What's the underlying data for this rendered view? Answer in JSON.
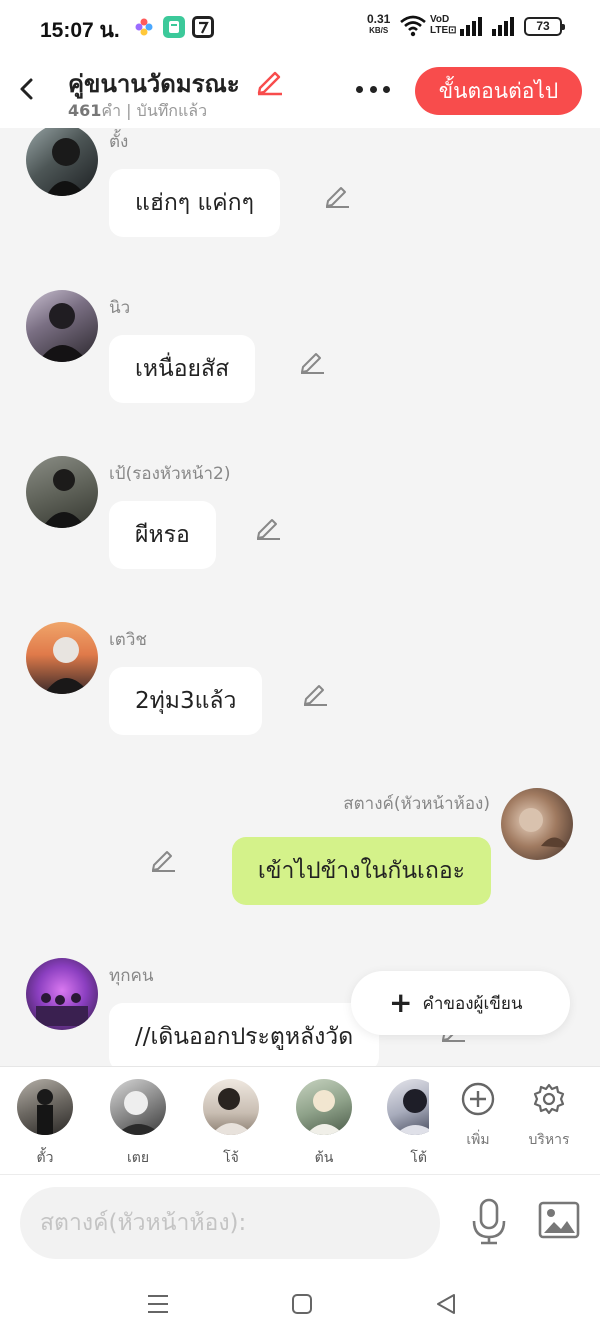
{
  "status_bar": {
    "time": "15:07 น.",
    "net_speed_value": "0.31",
    "net_speed_unit": "KB/S",
    "volte_top": "VoD",
    "volte_bottom": "LTE⊡",
    "battery": "73"
  },
  "header": {
    "title": "คู่ขนานวัดมรณะ",
    "word_count": "461",
    "word_unit": "คำ",
    "saved_status": "บันทึกแล้ว",
    "next_button": "ขั้นตอนต่อไป"
  },
  "messages": [
    {
      "speaker": "ตั้ง",
      "text": "แฮ่กๆ แค่กๆ",
      "side": "left"
    },
    {
      "speaker": "นิว",
      "text": "เหนื่อยสัส",
      "side": "left"
    },
    {
      "speaker": "เป้(รองหัวหน้า2)",
      "text": "ผีหรอ",
      "side": "left"
    },
    {
      "speaker": "เตวิช",
      "text": "2ทุ่ม3แล้ว",
      "side": "left"
    },
    {
      "speaker": "สตางค์(หัวหน้าห้อง)",
      "text": "เข้าไปข้างในกันเถอะ",
      "side": "right"
    },
    {
      "speaker": "ทุกคน",
      "text": "//เดินออกประตูหลังวัด",
      "side": "left"
    }
  ],
  "fab": {
    "label": "คำของผู้เขียน"
  },
  "characters": [
    {
      "name": "ตั้ว"
    },
    {
      "name": "เตย"
    },
    {
      "name": "โจ้"
    },
    {
      "name": "ต้น"
    },
    {
      "name": "โต้"
    }
  ],
  "tools": {
    "add_label": "เพิ่ม",
    "manage_label": "บริหาร"
  },
  "input": {
    "placeholder": "สตางค์(หัวหน้าห้อง):"
  },
  "colors": {
    "accent": "#f84c4c",
    "my_bubble": "#d4f28a",
    "background": "#f4f4f4"
  }
}
